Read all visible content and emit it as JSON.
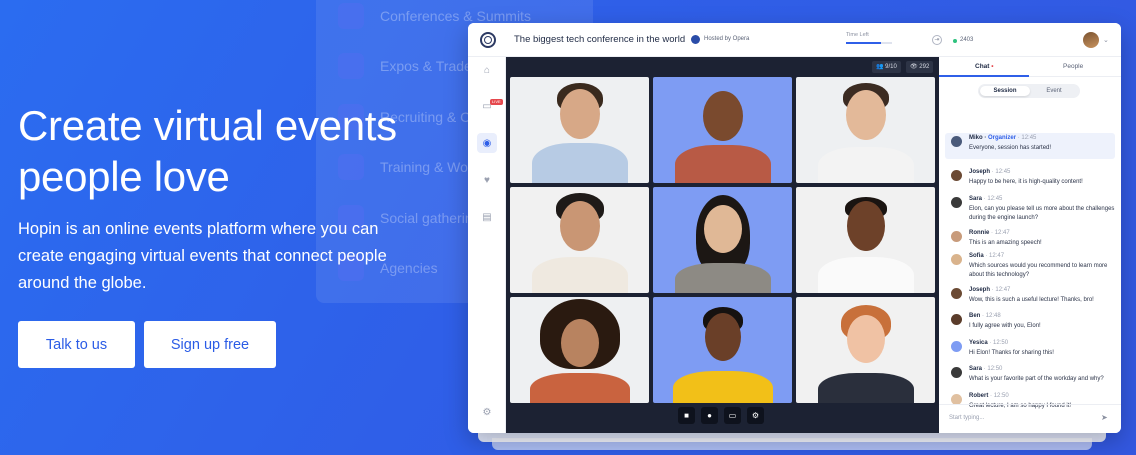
{
  "background_menu": {
    "items": [
      "Conferences & Summits",
      "Expos & Tradeshows",
      "Recruiting & Career Fairs",
      "Training & Workshops",
      "Social gatherings",
      "Agencies"
    ]
  },
  "hero": {
    "title_line1": "Create virtual events",
    "title_line2": "people love",
    "subtitle": "Hopin is an online events platform where you can create engaging virtual events that connect people around the globe.",
    "talk_label": "Talk to us",
    "signup_label": "Sign up free"
  },
  "app": {
    "event_title": "The biggest tech conference in the world",
    "hosted_by": "Hosted by Opera",
    "time_left_label": "Time Left",
    "time_progress": 0.75,
    "online_count": "2403",
    "stage": {
      "people_count": "9/10",
      "viewers_count": "292"
    },
    "sidebar": {
      "live_badge": "LIVE"
    },
    "chat": {
      "tabs": [
        "Chat",
        "People"
      ],
      "segments": [
        "Session",
        "Event"
      ],
      "placeholder": "Start typing...",
      "messages": [
        {
          "name": "Miko",
          "role": "Organizer",
          "time": "12:45",
          "text": "Everyone, session has started!"
        },
        {
          "name": "Joseph",
          "role": "",
          "time": "12:45",
          "text": "Happy to be here, it is high-quality content!"
        },
        {
          "name": "Sara",
          "role": "",
          "time": "12:45",
          "text": "Elon, can you please tell us more about the challenges during the engine launch?"
        },
        {
          "name": "Ronnie",
          "role": "",
          "time": "12:47",
          "text": "This is an amazing speech!"
        },
        {
          "name": "Sofia",
          "role": "",
          "time": "12:47",
          "text": "Which sources would you recommend to learn more about this technology?"
        },
        {
          "name": "Joseph",
          "role": "",
          "time": "12:47",
          "text": "Wow, this is such a useful lecture! Thanks, bro!"
        },
        {
          "name": "Ben",
          "role": "",
          "time": "12:48",
          "text": "I fully agree with you, Elon!"
        },
        {
          "name": "Yesica",
          "role": "",
          "time": "12:50",
          "text": "Hi Elon! Thanks for sharing this!"
        },
        {
          "name": "Sara",
          "role": "",
          "time": "12:50",
          "text": "What is your favorite part of the workday and why?"
        },
        {
          "name": "Robert",
          "role": "",
          "time": "12:50",
          "text": "Great lecture, I am so happy I found it!"
        }
      ]
    }
  },
  "colors": {
    "brand_blue": "#2f5fe8",
    "tile_blue": "#7e9cf3"
  }
}
